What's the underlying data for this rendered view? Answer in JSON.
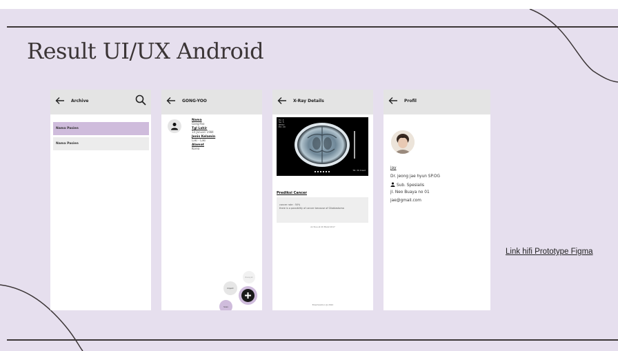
{
  "slide": {
    "title": "Result UI/UX Android",
    "background": "#e6dfee",
    "link_text": "Link hifi Prototype Figma"
  },
  "archive": {
    "title": "Archive",
    "items": [
      {
        "label": "Nama Pasien",
        "selected": true
      },
      {
        "label": "Nama Pasien",
        "selected": false
      }
    ]
  },
  "patient": {
    "title": "GONG-YOO",
    "fields": [
      {
        "label": "Nama",
        "value": "Gong-Yoo"
      },
      {
        "label": "Tgl Lahir",
        "value": "14 Januari 1984"
      },
      {
        "label": "Jenis Kelamin",
        "value": "Laki - Laki"
      },
      {
        "label": "Alamat",
        "value": "Korea"
      }
    ],
    "fab": {
      "history": "Riwayat",
      "import": "Import",
      "scan": "Scan"
    }
  },
  "xray": {
    "title": "X-Ray Details",
    "overlay_tl": [
      "Ex: 4",
      "Se: 5",
      "DFOV",
      "EX: 20"
    ],
    "overlay_br": "TR: 30 Inxed",
    "prediction_label": "Prediksi Cancer",
    "prediction_lines": [
      "cancer rate : 50%",
      "there is a possibility of cancer because of Glioblastoma"
    ],
    "archived_note": "Archive at 20 Maret 2017",
    "footer": "BrainSolution @ 2022"
  },
  "profile": {
    "title": "Profil",
    "username": "jay",
    "doctor": "Dr. jeong jae hyun SP.OG",
    "specialty": "Sub. Spesialis",
    "address": "jl. Neo Buaya no 01",
    "email": "jae@gmail.com"
  },
  "colors": {
    "accent": "#cfbcdc",
    "appbar": "#e4e4e4",
    "dark": "#3b3536"
  }
}
